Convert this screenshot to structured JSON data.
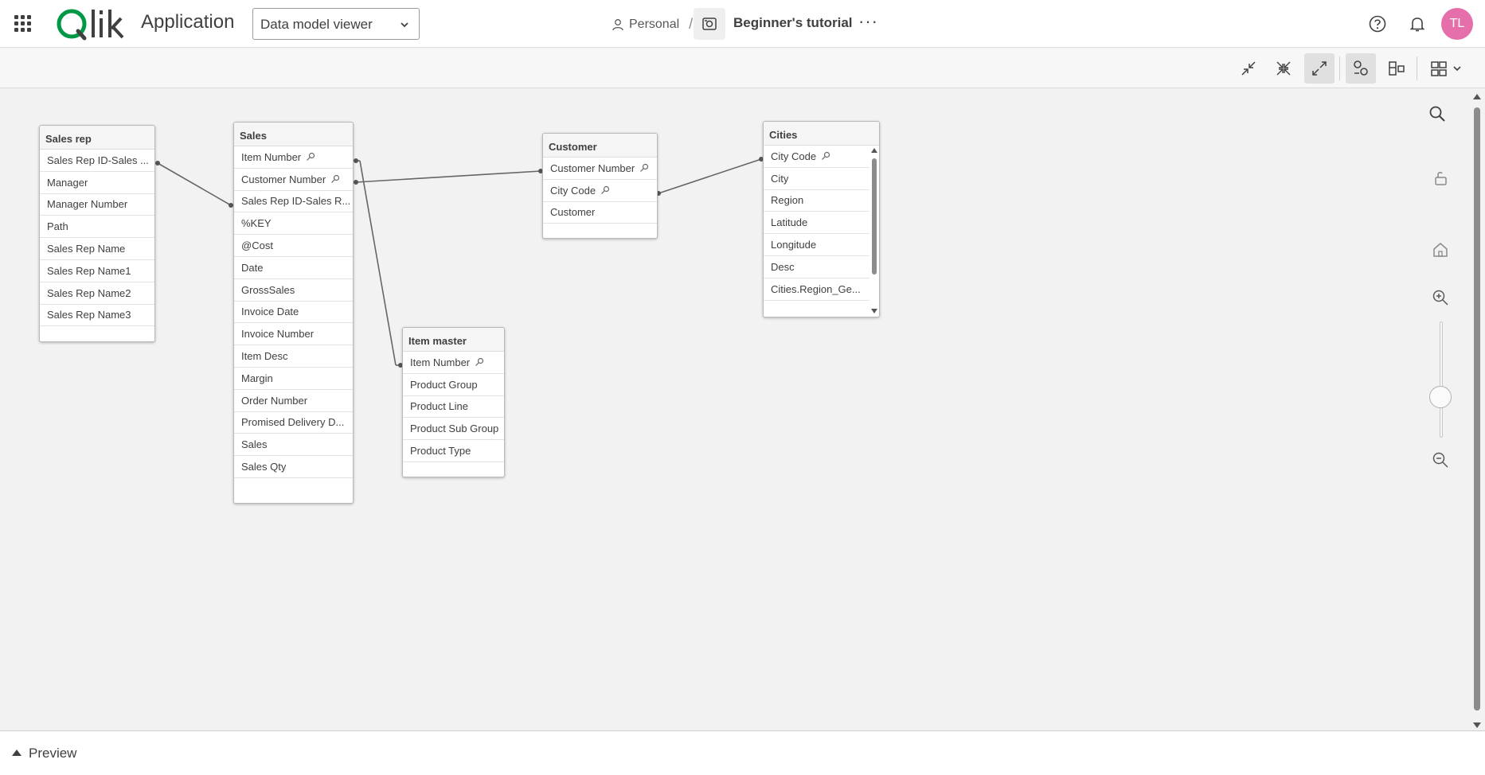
{
  "header": {
    "app_title": "Application",
    "view_select": "Data model viewer",
    "space": "Personal",
    "separator": "/",
    "sheet_title": "Beginner's tutorial",
    "more": "···",
    "avatar_initials": "TL",
    "avatar_color": "#e46fab",
    "logo_accent": "#009845"
  },
  "tables": {
    "sales_rep": {
      "title": "Sales rep",
      "fields": [
        "Sales Rep ID-Sales ...",
        "Manager",
        "Manager Number",
        "Path",
        "Sales Rep Name",
        "Sales Rep Name1",
        "Sales Rep Name2",
        "Sales Rep Name3"
      ]
    },
    "sales": {
      "title": "Sales",
      "fields": [
        "Item Number",
        "Customer Number",
        "Sales Rep ID-Sales R...",
        "%KEY",
        "@Cost",
        "Date",
        "GrossSales",
        "Invoice Date",
        "Invoice Number",
        "Item Desc",
        "Margin",
        "Order Number",
        "Promised Delivery D...",
        "Sales",
        "Sales Qty"
      ]
    },
    "customer": {
      "title": "Customer",
      "fields": [
        "Customer Number",
        "City Code",
        "Customer"
      ]
    },
    "cities": {
      "title": "Cities",
      "fields": [
        "City Code",
        "City",
        "Region",
        "Latitude",
        "Longitude",
        "Desc",
        "Cities.Region_Ge..."
      ]
    },
    "item_master": {
      "title": "Item master",
      "fields": [
        "Item Number",
        "Product Group",
        "Product Line",
        "Product Sub Group",
        "Product Type"
      ]
    }
  },
  "preview": {
    "label": "Preview"
  }
}
